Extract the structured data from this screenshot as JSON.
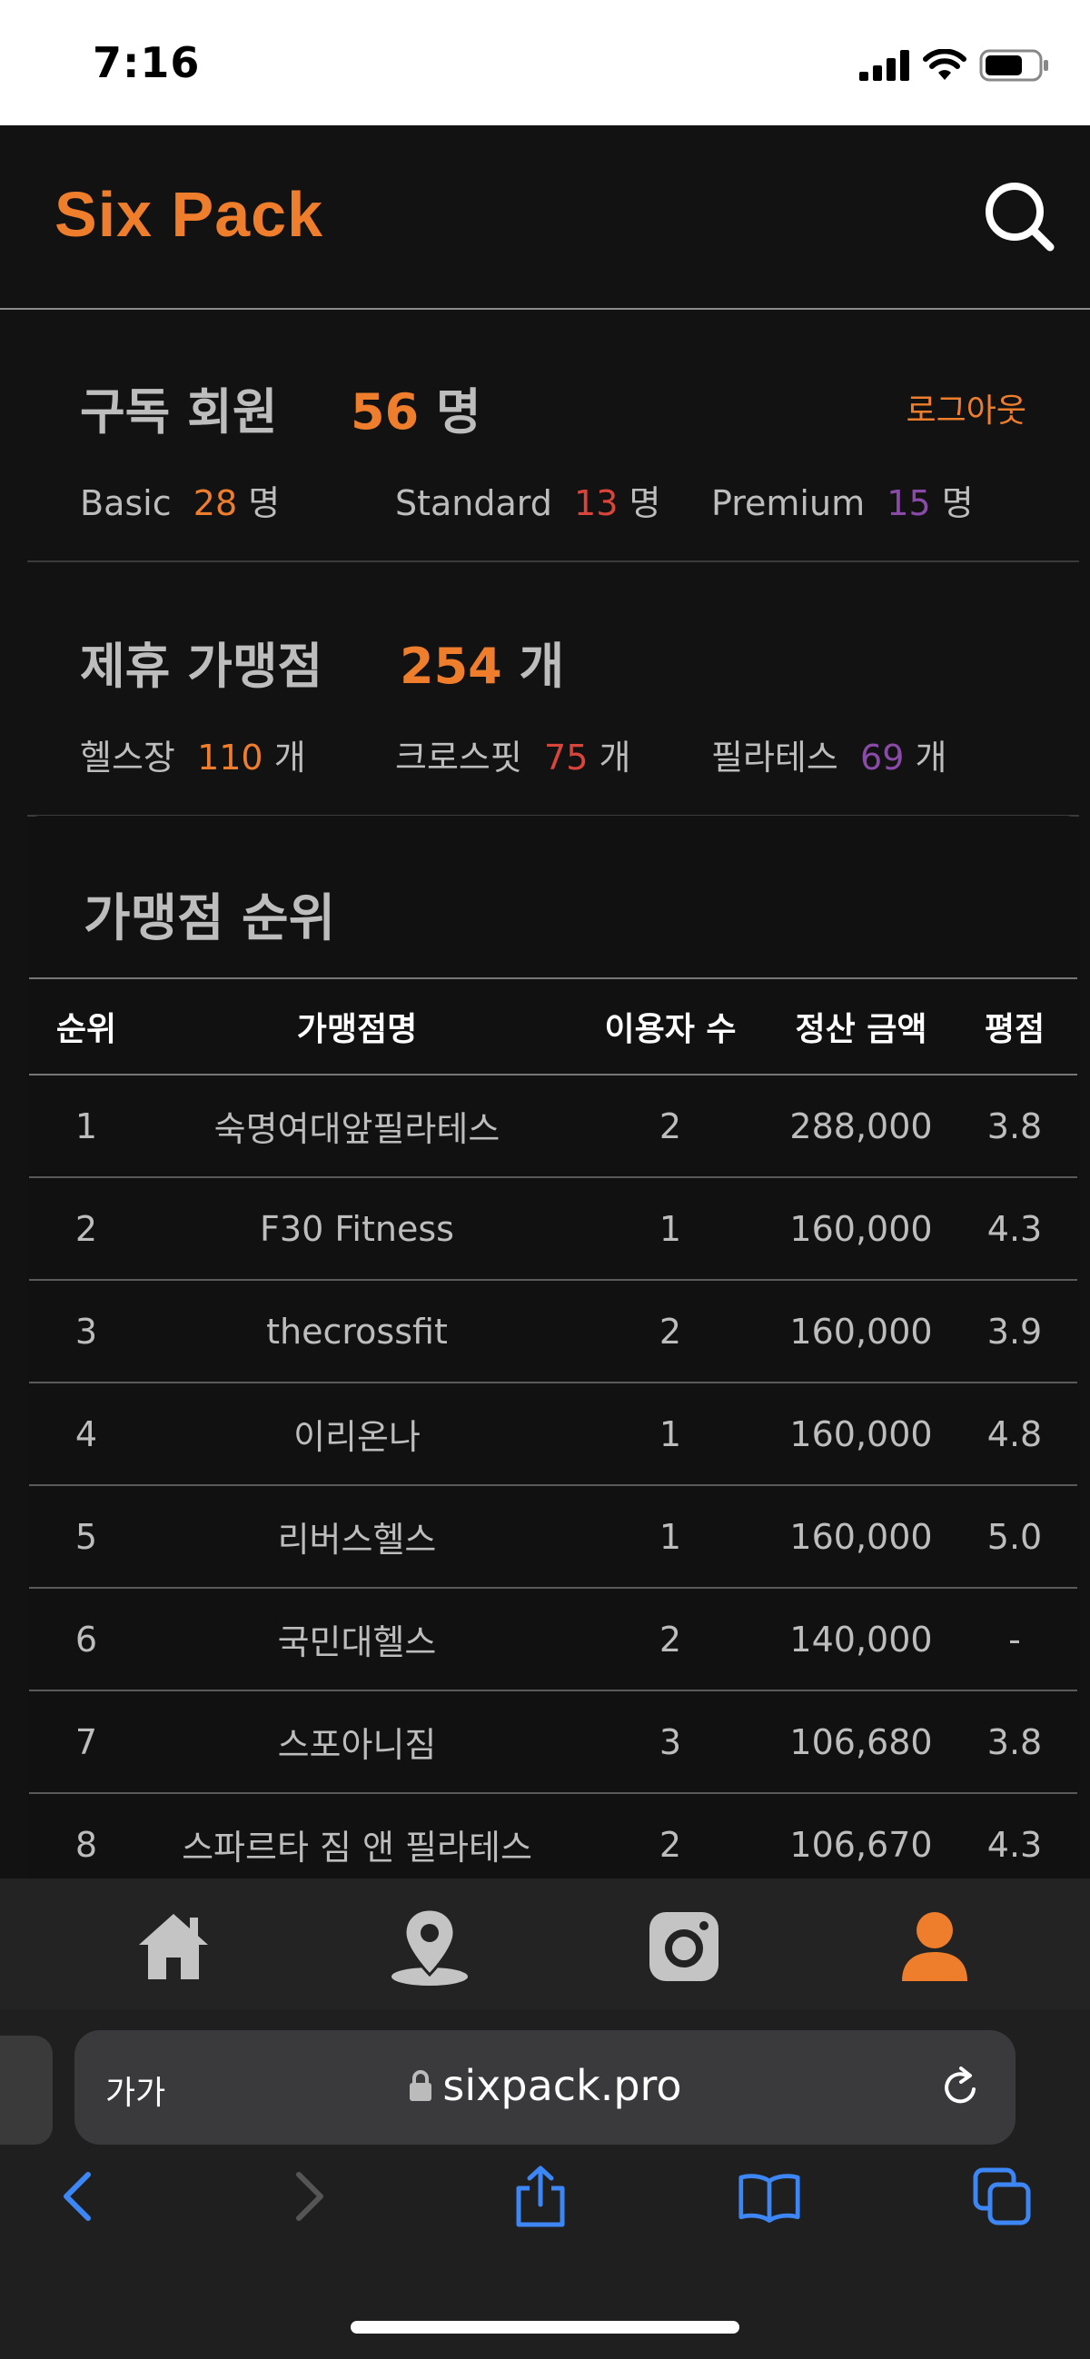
{
  "status": {
    "time": "7:16"
  },
  "header": {
    "brand": "Six Pack"
  },
  "subscribers": {
    "title": "구독 회원",
    "total_num": "56",
    "total_unit": "명",
    "logout": "로그아웃",
    "items": [
      {
        "label": "Basic",
        "count": "28",
        "unit": "명"
      },
      {
        "label": "Standard",
        "count": "13",
        "unit": "명"
      },
      {
        "label": "Premium",
        "count": "15",
        "unit": "명"
      }
    ]
  },
  "partners": {
    "title": "제휴 가맹점",
    "total_num": "254",
    "total_unit": "개",
    "items": [
      {
        "label": "헬스장",
        "count": "110",
        "unit": "개"
      },
      {
        "label": "크로스핏",
        "count": "75",
        "unit": "개"
      },
      {
        "label": "필라테스",
        "count": "69",
        "unit": "개"
      }
    ]
  },
  "ranking": {
    "title": "가맹점 순위",
    "columns": [
      "순위",
      "가맹점명",
      "이용자 수",
      "정산 금액",
      "평점"
    ],
    "rows": [
      [
        "1",
        "숙명여대앞필라테스",
        "2",
        "288,000",
        "3.8"
      ],
      [
        "2",
        "F30 Fitness",
        "1",
        "160,000",
        "4.3"
      ],
      [
        "3",
        "thecrossfit",
        "2",
        "160,000",
        "3.9"
      ],
      [
        "4",
        "이리온나",
        "1",
        "160,000",
        "4.8"
      ],
      [
        "5",
        "리버스헬스",
        "1",
        "160,000",
        "5.0"
      ],
      [
        "6",
        "국민대헬스",
        "2",
        "140,000",
        "-"
      ],
      [
        "7",
        "스포아니짐",
        "3",
        "106,680",
        "3.8"
      ],
      [
        "8",
        "스파르타 짐 앤 필라테스",
        "2",
        "106,670",
        "4.3"
      ]
    ]
  },
  "tabs": [
    {
      "icon": "home-icon"
    },
    {
      "icon": "map-pin-icon"
    },
    {
      "icon": "instagram-icon"
    },
    {
      "icon": "user-icon",
      "active": true
    }
  ],
  "browser": {
    "text_size": "가가",
    "url": "sixpack.pro"
  },
  "colors": {
    "accent": "#ee7d2c",
    "standard": "#d9453b",
    "premium": "#8a4aa8",
    "ios_blue": "#3d86f5"
  }
}
